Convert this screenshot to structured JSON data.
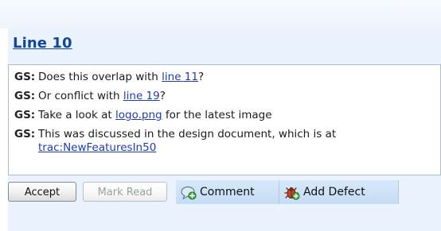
{
  "header": {
    "title": "Line 10"
  },
  "comments": [
    {
      "author": "GS:",
      "before": "Does this overlap with ",
      "link": "line 11",
      "after": "?"
    },
    {
      "author": "GS:",
      "before": "Or conflict with ",
      "link": "line 19",
      "after": "?"
    },
    {
      "author": "GS:",
      "before": "Take a look at ",
      "link": "logo.png",
      "after": " for the latest image"
    },
    {
      "author": "GS:",
      "before": "This was discussed in the design document, which is at",
      "link": "trac:NewFeaturesIn50",
      "after": ""
    }
  ],
  "toolbar": {
    "accept_label": "Accept",
    "mark_read_label": "Mark Read",
    "comment_label": "Comment",
    "add_defect_label": "Add Defect"
  },
  "icons": {
    "comment": "speech-bubble-add-icon",
    "add_defect": "bug-add-icon"
  },
  "colors": {
    "link": "#1e3cb0",
    "title": "#12469a",
    "panel_bg": "#eaf3fd",
    "tab_bg": "#c9def6"
  }
}
